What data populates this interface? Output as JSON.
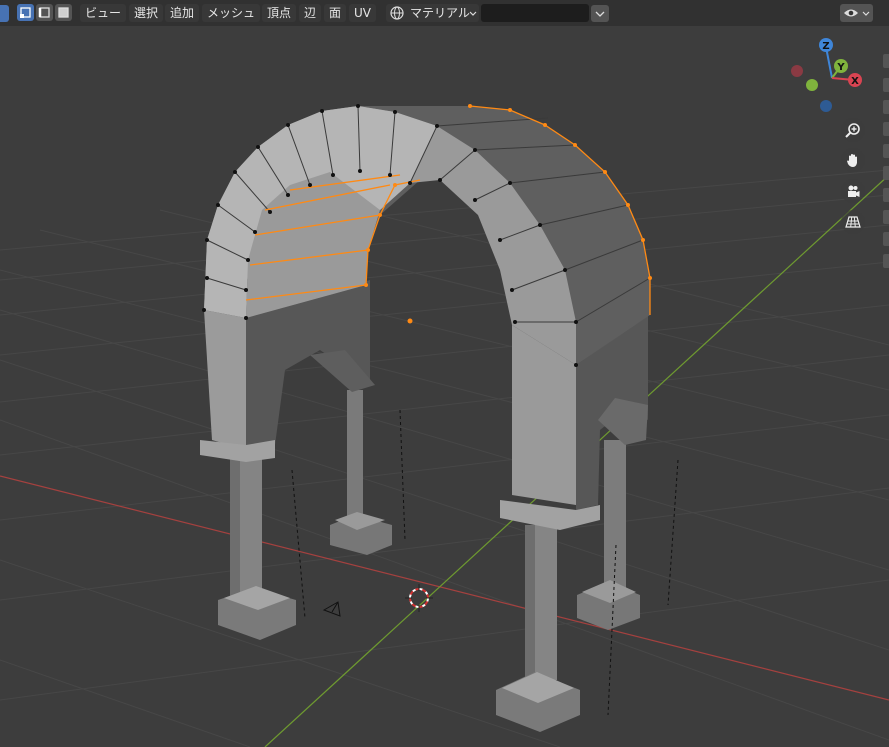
{
  "header": {
    "menu": {
      "view": "ビュー",
      "select": "選択",
      "add": "追加",
      "mesh": "メッシュ",
      "vertex": "頂点",
      "edge": "辺",
      "face": "面",
      "uv": "UV"
    },
    "transform_orientation": "マテリアル",
    "search": {
      "value": ""
    }
  },
  "gizmo": {
    "z": "Z",
    "y": "Y",
    "x": "X"
  },
  "colors": {
    "viewport_bg": "#3d3d3d",
    "x_axis": "#d94452",
    "y_axis": "#7fb33d",
    "z_axis": "#3f86d9",
    "selection": "#ff8a14",
    "mode_active": "#4772b3"
  },
  "icons": [
    "vertex-select-icon",
    "edge-select-icon",
    "face-select-icon",
    "sphere-shading-icon",
    "search-icon",
    "zoom-icon",
    "hand-pan-icon",
    "camera-icon",
    "grid-perspective-icon",
    "eye-icon",
    "chevron-down-icon"
  ]
}
